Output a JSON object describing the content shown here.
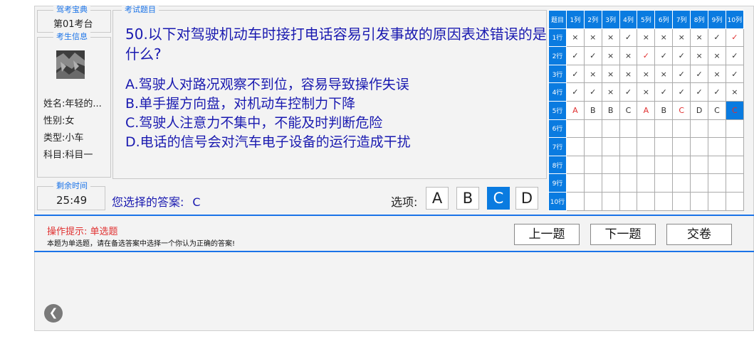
{
  "left": {
    "title_legend": "驾考宝典",
    "seat": "第01考台",
    "info_legend": "考生信息",
    "name": "姓名:年轻的...",
    "gender": "性别:女",
    "type": "类型:小车",
    "subject": "科目:科目一",
    "timer_legend": "剩余时间",
    "timer": "25:49"
  },
  "question": {
    "legend": "考试题目",
    "text": "50.以下对驾驶机动车时接打电话容易引发事故的原因表述错误的是什么?",
    "options": [
      "A.驾驶人对路况观察不到位，容易导致操作失误",
      "B.单手握方向盘，对机动车控制力下降",
      "C.驾驶人注意力不集中，不能及时判断危险",
      "D.电话的信号会对汽车电子设备的运行造成干扰"
    ],
    "answer_label": "您选择的答案:",
    "answer_value": "C",
    "options_label": "选项:",
    "choice_buttons": [
      "A",
      "B",
      "C",
      "D"
    ],
    "selected": "C"
  },
  "hint": {
    "title": "操作提示: 单选题",
    "body": "本题为单选题，请在备选答案中选择一个你认为正确的答案!"
  },
  "nav": {
    "prev": "上一题",
    "next": "下一题",
    "submit": "交卷"
  },
  "grid": {
    "corner": "题目",
    "col_headers": [
      "1列",
      "2列",
      "3列",
      "4列",
      "5列",
      "6列",
      "7列",
      "8列",
      "9列",
      "10列"
    ],
    "row_headers": [
      "1行",
      "2行",
      "3行",
      "4行",
      "5行",
      "6行",
      "7行",
      "8行",
      "9行",
      "10行"
    ],
    "rows": [
      [
        "×",
        "×",
        "×",
        "✓",
        "×",
        "×",
        "×",
        "×",
        "✓",
        "✓"
      ],
      [
        "✓",
        "✓",
        "×",
        "×",
        "✓",
        "✓",
        "✓",
        "×",
        "×",
        "✓"
      ],
      [
        "✓",
        "×",
        "×",
        "×",
        "×",
        "×",
        "✓",
        "✓",
        "×",
        "✓"
      ],
      [
        "✓",
        "✓",
        "×",
        "✓",
        "×",
        "✓",
        "✓",
        "✓",
        "✓",
        "×"
      ],
      [
        "A",
        "B",
        "B",
        "C",
        "A",
        "B",
        "C",
        "D",
        "C",
        "C"
      ],
      [
        "",
        "",
        "",
        "",
        "",
        "",
        "",
        "",
        "",
        ""
      ],
      [
        "",
        "",
        "",
        "",
        "",
        "",
        "",
        "",
        "",
        ""
      ],
      [
        "",
        "",
        "",
        "",
        "",
        "",
        "",
        "",
        "",
        ""
      ],
      [
        "",
        "",
        "",
        "",
        "",
        "",
        "",
        "",
        "",
        ""
      ],
      [
        "",
        "",
        "",
        "",
        "",
        "",
        "",
        "",
        "",
        ""
      ]
    ],
    "wrong_cells": [
      "0-9",
      "1-4",
      "4-0",
      "4-4",
      "4-6"
    ],
    "current_cell": "4-9"
  },
  "colors": {
    "accent": "#0a7be0",
    "wrong": "#e03030",
    "question_text": "#1a1ab0"
  }
}
